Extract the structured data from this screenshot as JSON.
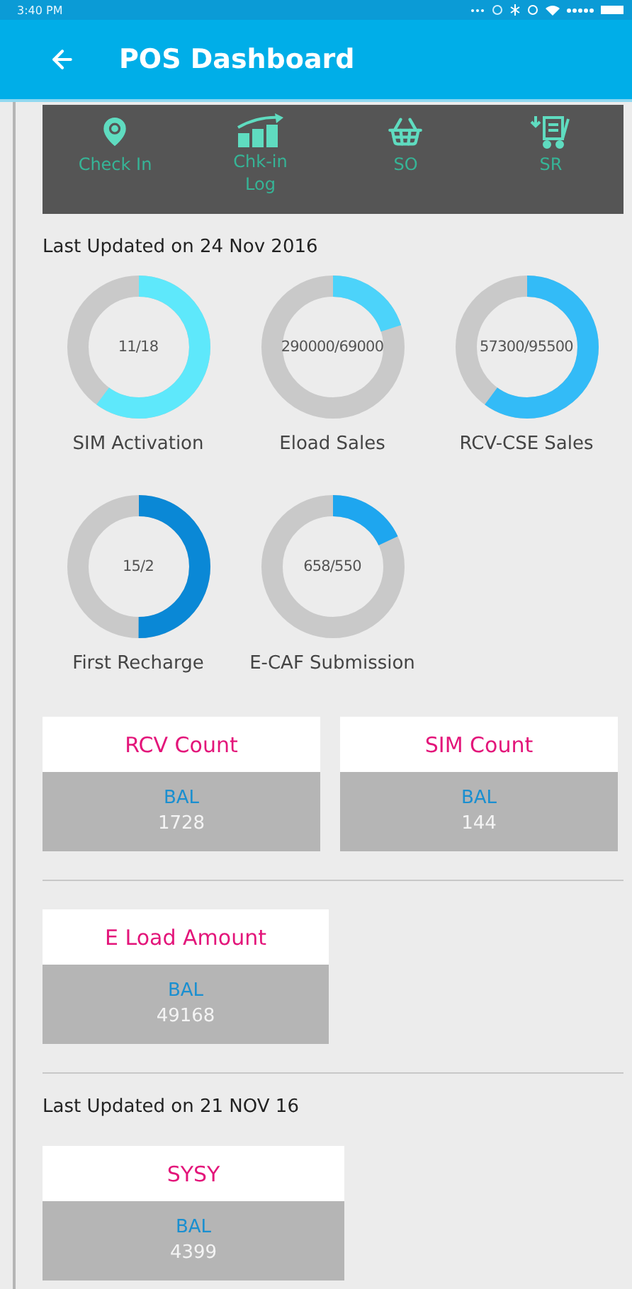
{
  "status_bar": {
    "time": "3:40 PM"
  },
  "app_bar": {
    "title": "POS Dashboard"
  },
  "actions": [
    {
      "label": "Check In",
      "kind": "pin"
    },
    {
      "label": "Chk-in Log",
      "kind": "chart"
    },
    {
      "label": "SO",
      "kind": "basket"
    },
    {
      "label": "SR",
      "kind": "cart"
    }
  ],
  "updated_1": "Last Updated on 24 Nov 2016",
  "gauges": [
    {
      "reading": "11/18",
      "label": "SIM Activation",
      "level": 0.6,
      "color": "#5ee8fb"
    },
    {
      "reading": "290000/69000",
      "label": "Eload Sales",
      "level": 0.2,
      "color": "#4cd3fa"
    },
    {
      "reading": "57300/95500",
      "label": "RCV-CSE Sales",
      "level": 0.6,
      "color": "#33bbf7"
    },
    {
      "reading": "15/2",
      "label": "First Recharge",
      "level": 0.5,
      "color": "#0a88d6"
    },
    {
      "reading": "658/550",
      "label": "E-CAF Submission",
      "level": 0.18,
      "color": "#1ea6ef"
    }
  ],
  "count_cards": [
    {
      "title": "RCV Count",
      "label": "BAL",
      "value": "1728"
    },
    {
      "title": "SIM Count",
      "label": "BAL",
      "value": "144"
    }
  ],
  "amount_cards": [
    {
      "title": "E Load Amount",
      "label": "BAL",
      "value": "49168"
    }
  ],
  "updated_2": "Last Updated on 21 NOV 16",
  "other_cards": [
    {
      "title": "SYSY",
      "label": "BAL",
      "value": "4399"
    }
  ]
}
